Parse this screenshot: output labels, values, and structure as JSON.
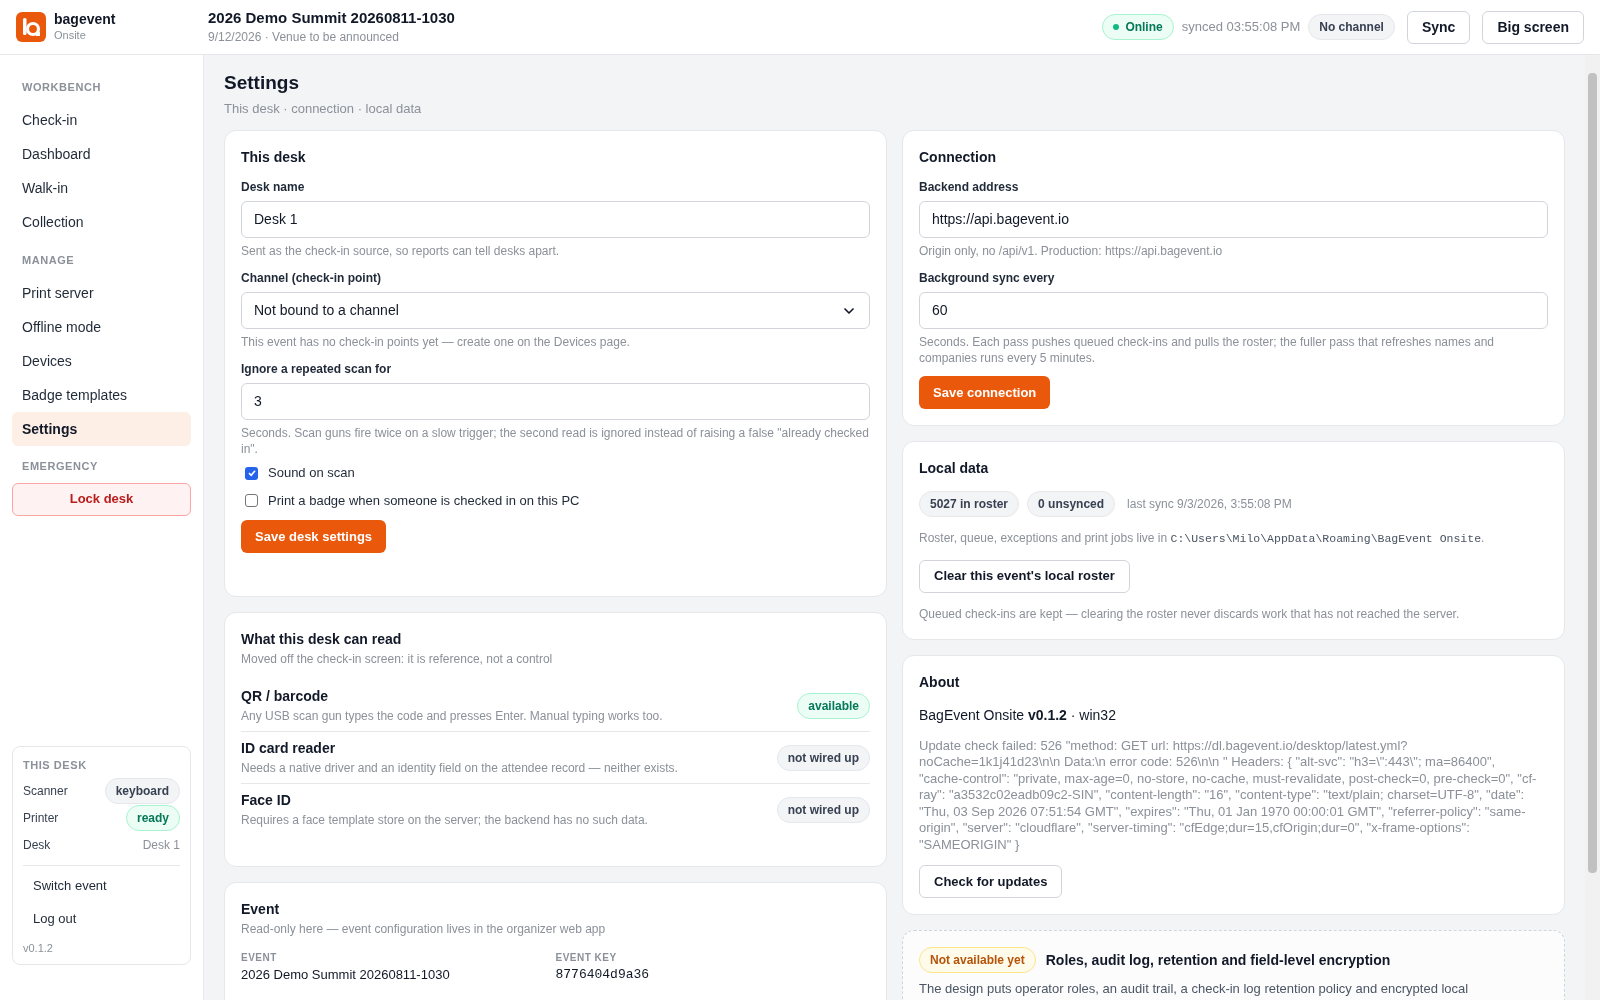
{
  "app": {
    "name": "bagevent",
    "subtitle": "Onsite"
  },
  "event_header": {
    "title": "2026 Demo Summit 20260811-1030",
    "subtitle": "9/12/2026 · Venue to be announced"
  },
  "status": {
    "connection": {
      "label": "Online",
      "kind": "online"
    },
    "synced": "synced 03:55:08 PM",
    "channel": "No channel"
  },
  "header_buttons": [
    "Sync",
    "Big screen"
  ],
  "sidebar": {
    "sections": [
      {
        "heading": "WORKBENCH",
        "items": [
          {
            "label": "Check-in",
            "selected": false
          },
          {
            "label": "Dashboard",
            "selected": false
          },
          {
            "label": "Walk-in",
            "selected": false
          },
          {
            "label": "Collection",
            "selected": false
          }
        ]
      },
      {
        "heading": "MANAGE",
        "items": [
          {
            "label": "Print server",
            "selected": false
          },
          {
            "label": "Offline mode",
            "selected": false
          },
          {
            "label": "Devices",
            "selected": false
          },
          {
            "label": "Badge templates",
            "selected": false
          },
          {
            "label": "Settings",
            "selected": true
          }
        ]
      }
    ],
    "emergency": {
      "heading": "EMERGENCY",
      "button": "Lock desk"
    },
    "desk_panel": {
      "heading": "THIS DESK",
      "rows": [
        {
          "label": "Scanner",
          "value": "keyboard",
          "kind": "neutral"
        },
        {
          "label": "Printer",
          "value": "ready",
          "kind": "success"
        },
        {
          "label": "Desk",
          "value": "Desk 1",
          "kind": "text"
        }
      ],
      "actions": [
        "Switch event",
        "Log out"
      ],
      "version": "v0.1.2"
    }
  },
  "page": {
    "title": "Settings",
    "subtitle": "This desk · connection · local data"
  },
  "this_desk": {
    "title": "This desk",
    "fields": [
      {
        "label": "Desk name",
        "kind": "input",
        "value": "Desk 1",
        "hint": "Sent as the check-in source, so reports can tell desks apart."
      },
      {
        "label": "Channel (check-in point)",
        "kind": "select",
        "value": "Not bound to a channel",
        "hint": "This event has no check-in points yet — create one on the Devices page."
      },
      {
        "label": "Ignore a repeated scan for",
        "kind": "input",
        "value": "3",
        "hint": "Seconds. Scan guns fire twice on a slow trigger; the second read is ignored instead of raising a false \"already checked in\"."
      }
    ],
    "checkboxes": [
      {
        "label": "Sound on scan",
        "checked": true
      },
      {
        "label": "Print a badge when someone is checked in on this PC",
        "checked": false
      }
    ],
    "button": "Save desk settings"
  },
  "readers": {
    "title": "What this desk can read",
    "subtitle": "Moved off the check-in screen: it is reference, not a control",
    "items": [
      {
        "name": "QR / barcode",
        "description": "Any USB scan gun types the code and presses Enter. Manual typing works too.",
        "status": "available",
        "kind": "success"
      },
      {
        "name": "ID card reader",
        "description": "Needs a native driver and an identity field on the attendee record — neither exists.",
        "status": "not wired up",
        "kind": "neutral"
      },
      {
        "name": "Face ID",
        "description": "Requires a face template store on the server; the backend has no such data.",
        "status": "not wired up",
        "kind": "neutral"
      }
    ]
  },
  "event": {
    "title": "Event",
    "subtitle": "Read-only here — event configuration lives in the organizer web app",
    "fields": [
      {
        "label": "EVENT",
        "value": "2026 Demo Summit 20260811-1030",
        "kind": "text"
      },
      {
        "label": "EVENT KEY",
        "value": "8776404d9a36",
        "kind": "mono"
      }
    ]
  },
  "connection": {
    "title": "Connection",
    "fields": [
      {
        "label": "Backend address",
        "kind": "input",
        "value": "https://api.bagevent.io",
        "hint": "Origin only, no /api/v1. Production: https://api.bagevent.io"
      },
      {
        "label": "Background sync every",
        "kind": "input",
        "value": "60",
        "hint": "Seconds. Each pass pushes queued check-ins and pulls the roster; the fuller pass that refreshes names and companies runs every 5 minutes."
      }
    ],
    "button": "Save connection"
  },
  "local_data": {
    "title": "Local data",
    "badges": [
      "5027 in roster",
      "0 unsynced"
    ],
    "last_sync": "last sync 9/3/2026, 3:55:08 PM",
    "storage_text": "Roster, queue, exceptions and print jobs live in",
    "storage_path": "C:\\Users\\Milo\\AppData\\Roaming\\BagEvent Onsite",
    "storage_end": ".",
    "button": "Clear this event's local roster",
    "note": "Queued check-ins are kept — clearing the roster never discards work that has not reached the server."
  },
  "about": {
    "title": "About",
    "version_line": "BagEvent Onsite **v0.1.2** · win32",
    "error": "Update check failed: 526 \"method: GET url: https://dl.bagevent.io/desktop/latest.yml?noCache=1k1j41d23\\n\\n Data:\\n error code: 526\\n\\n \" Headers: { \"alt-svc\": \"h3=\\\":443\\\"; ma=86400\", \"cache-control\": \"private, max-age=0, no-store, no-cache, must-revalidate, post-check=0, pre-check=0\", \"cf-ray\": \"a3532c02eadb09c2-SIN\", \"content-length\": \"16\", \"content-type\": \"text/plain; charset=UTF-8\", \"date\": \"Thu, 03 Sep 2026 07:51:54 GMT\", \"expires\": \"Thu, 01 Jan 1970 00:00:01 GMT\", \"referrer-policy\": \"same-origin\", \"server\": \"cloudflare\", \"server-timing\": \"cfEdge;dur=15,cfOrigin;dur=0\", \"x-frame-options\": \"SAMEORIGIN\" }",
    "button": "Check for updates"
  },
  "roadmap": {
    "badge": "Not available yet",
    "title": "Roles, audit log, retention and field-level encryption",
    "text": "The design puts operator roles, an audit trail, a check-in log retention policy and encrypted local"
  }
}
